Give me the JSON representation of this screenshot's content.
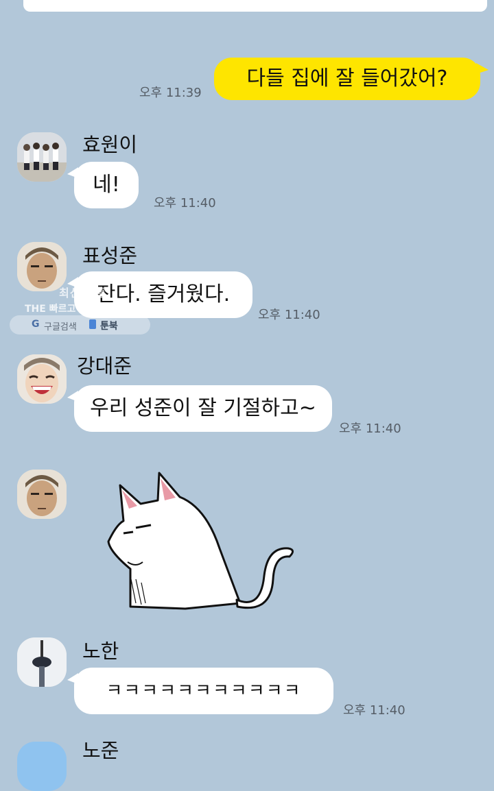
{
  "messages": [
    {
      "sender": "me",
      "text": "다들 집에 잘 들어갔어?",
      "time": "오후 11:39"
    },
    {
      "sender": "효원이",
      "text": "네!",
      "time": "오후 11:40"
    },
    {
      "sender": "표성준",
      "text": "잔다. 즐거웠다.",
      "time": "오후 11:40"
    },
    {
      "sender": "강대준",
      "text": "우리 성준이 잘 기절하고~",
      "time": "오후 11:40"
    },
    {
      "sender": "표성준",
      "sticker": "white-cat-smug"
    },
    {
      "sender": "노한",
      "text": "ㅋㅋㅋㅋㅋㅋㅋㅋㅋㅋㅋ",
      "time": "오후 11:40"
    },
    {
      "sender": "노준"
    }
  ],
  "watermark": {
    "line1": "최신 웹툰",
    "line2": "THE 빠르고 THE 편하게",
    "search_label": "구글검색",
    "brand": "툰북"
  },
  "colors": {
    "background": "#b2c7d9",
    "my_bubble": "#fee500",
    "their_bubble": "#ffffff"
  }
}
